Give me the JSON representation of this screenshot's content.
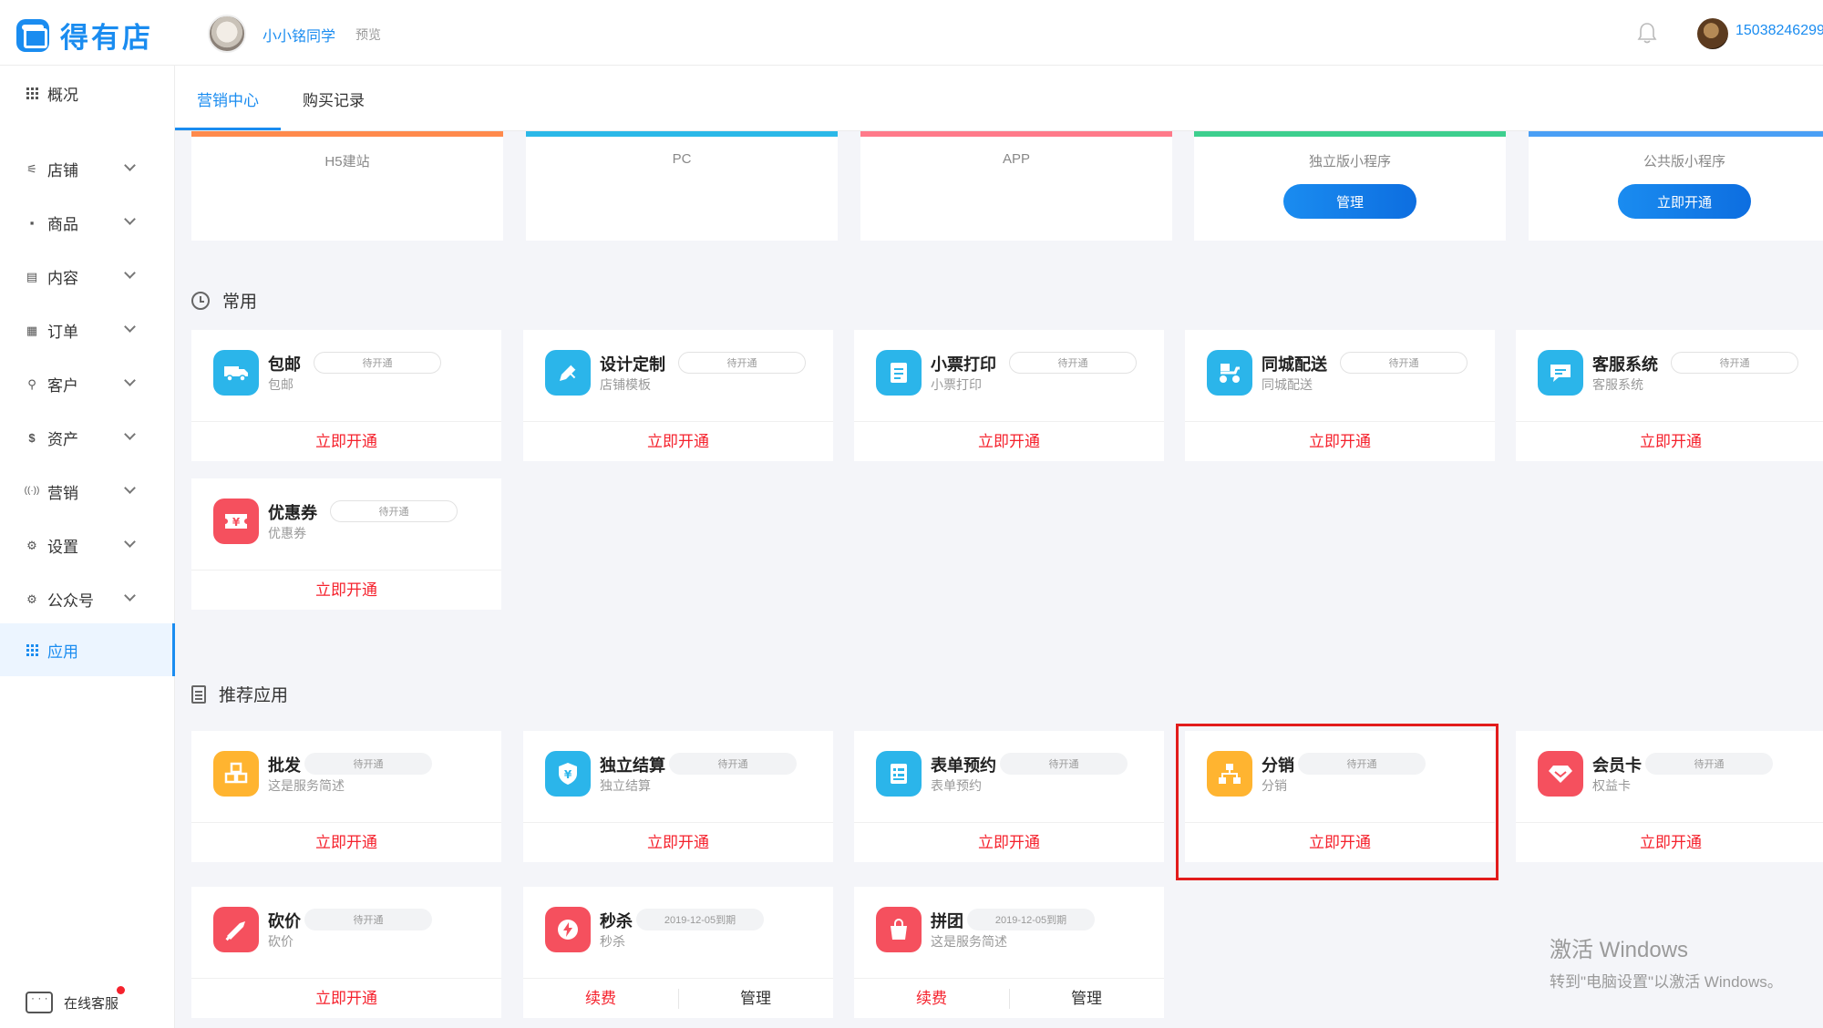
{
  "header": {
    "brand": "得有店",
    "shop_name": "小小铭同学",
    "preview_label": "预览",
    "user_phone": "15038246299"
  },
  "sidebar": {
    "items": [
      {
        "label": "概况",
        "icon": "grid-icon"
      },
      {
        "label": "店铺",
        "icon": "sliders-icon"
      },
      {
        "label": "商品",
        "icon": "box-icon"
      },
      {
        "label": "内容",
        "icon": "document-icon"
      },
      {
        "label": "订单",
        "icon": "list-icon"
      },
      {
        "label": "客户",
        "icon": "person-icon"
      },
      {
        "label": "资产",
        "icon": "dollar-icon"
      },
      {
        "label": "营销",
        "icon": "broadcast-icon"
      },
      {
        "label": "设置",
        "icon": "gear-icon"
      },
      {
        "label": "公众号",
        "icon": "gear-icon"
      },
      {
        "label": "应用",
        "icon": "grid-icon"
      }
    ],
    "active": "应用",
    "support_label": "在线客服"
  },
  "tabs": [
    {
      "label": "营销中心",
      "active": true
    },
    {
      "label": "购买记录",
      "active": false
    }
  ],
  "channels": [
    {
      "label": "H5建站",
      "bar_color": "#ff8a4c",
      "button": ""
    },
    {
      "label": "PC",
      "bar_color": "#2bb8e8",
      "button": ""
    },
    {
      "label": "APP",
      "bar_color": "#ff7a8a",
      "button": ""
    },
    {
      "label": "独立版小程序",
      "bar_color": "#3dcf8e",
      "button": "管理"
    },
    {
      "label": "公共版小程序",
      "bar_color": "#4a9ff5",
      "button": "立即开通"
    }
  ],
  "common_section": {
    "title": "常用",
    "apps": [
      {
        "name": "包邮",
        "desc": "包邮",
        "badge": "待开通",
        "action": "立即开通",
        "icon": "truck-icon",
        "color": "#2bb5ea"
      },
      {
        "name": "设计定制",
        "desc": "店铺模板",
        "badge": "待开通",
        "action": "立即开通",
        "icon": "brush-icon",
        "color": "#2bb5ea"
      },
      {
        "name": "小票打印",
        "desc": "小票打印",
        "badge": "待开通",
        "action": "立即开通",
        "icon": "receipt-icon",
        "color": "#2bb5ea"
      },
      {
        "name": "同城配送",
        "desc": "同城配送",
        "badge": "待开通",
        "action": "立即开通",
        "icon": "scooter-icon",
        "color": "#2bb5ea"
      },
      {
        "name": "客服系统",
        "desc": "客服系统",
        "badge": "待开通",
        "action": "立即开通",
        "icon": "chat-bubble-icon",
        "color": "#2bb5ea"
      },
      {
        "name": "优惠券",
        "desc": "优惠券",
        "badge": "待开通",
        "action": "立即开通",
        "icon": "coupon-icon",
        "color": "#f5505e"
      }
    ]
  },
  "recommended_section": {
    "title": "推荐应用",
    "apps": [
      {
        "name": "批发",
        "desc": "这是服务简述",
        "badge": "待开通",
        "action": "立即开通",
        "icon": "boxes-icon",
        "color": "#ffb430"
      },
      {
        "name": "独立结算",
        "desc": "独立结算",
        "badge": "待开通",
        "action": "立即开通",
        "icon": "shield-yen-icon",
        "color": "#2bb5ea"
      },
      {
        "name": "表单预约",
        "desc": "表单预约",
        "badge": "待开通",
        "action": "立即开通",
        "icon": "form-icon",
        "color": "#2bb5ea"
      },
      {
        "name": "分销",
        "desc": "分销",
        "badge": "待开通",
        "action": "立即开通",
        "icon": "network-icon",
        "color": "#ffb430"
      },
      {
        "name": "会员卡",
        "desc": "权益卡",
        "badge": "待开通",
        "action": "立即开通",
        "icon": "diamond-icon",
        "color": "#f5505e"
      },
      {
        "name": "砍价",
        "desc": "砍价",
        "badge": "待开通",
        "action": "立即开通",
        "icon": "knife-icon",
        "color": "#f5505e"
      },
      {
        "name": "秒杀",
        "desc": "秒杀",
        "badge": "2019-12-05到期",
        "action": "续费",
        "action2": "管理",
        "icon": "lightning-icon",
        "color": "#f5505e"
      },
      {
        "name": "拼团",
        "desc": "这是服务简述",
        "badge": "2019-12-05到期",
        "action": "续费",
        "action2": "管理",
        "icon": "bag-icon",
        "color": "#f5505e"
      }
    ]
  },
  "watermark": {
    "line1": "激活 Windows",
    "line2": "转到\"电脑设置\"以激活 Windows。"
  }
}
